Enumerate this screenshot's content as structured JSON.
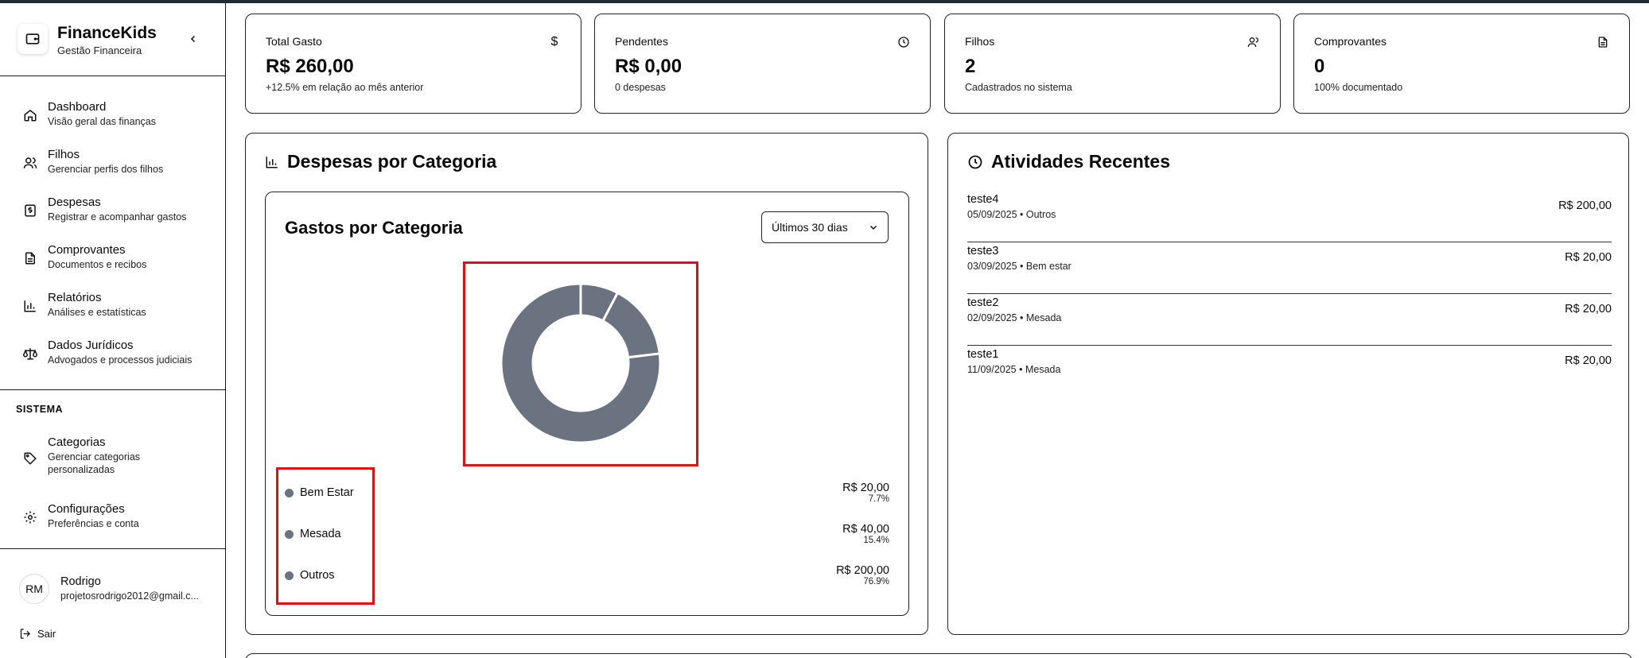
{
  "brand": {
    "name": "FinanceKids",
    "subtitle": "Gestão Financeira"
  },
  "nav": [
    {
      "title": "Dashboard",
      "desc": "Visão geral das finanças",
      "icon": "home-icon"
    },
    {
      "title": "Filhos",
      "desc": "Gerenciar perfis dos filhos",
      "icon": "users-icon"
    },
    {
      "title": "Despesas",
      "desc": "Registrar e acompanhar gastos",
      "icon": "receipt-dollar-icon"
    },
    {
      "title": "Comprovantes",
      "desc": "Documentos e recibos",
      "icon": "document-icon"
    },
    {
      "title": "Relatórios",
      "desc": "Análises e estatísticas",
      "icon": "bar-chart-icon"
    },
    {
      "title": "Dados Jurídicos",
      "desc": "Advogados e processos judiciais",
      "icon": "scale-icon"
    }
  ],
  "system": {
    "label": "SISTEMA",
    "items": [
      {
        "title": "Categorias",
        "desc_line1": "Gerenciar categorias",
        "desc_line2": "personalizadas",
        "icon": "tag-icon"
      },
      {
        "title": "Configurações",
        "desc": "Preferências e conta",
        "icon": "gear-icon"
      }
    ]
  },
  "user": {
    "initials": "RM",
    "name": "Rodrigo",
    "email": "projetosrodrigo2012@gmail.c..."
  },
  "logout": "Sair",
  "stats": [
    {
      "label": "Total Gasto",
      "value": "R$ 260,00",
      "sub": "+12.5% em relação ao mês anterior",
      "icon": "dollar-icon"
    },
    {
      "label": "Pendentes",
      "value": "R$ 0,00",
      "sub": "0 despesas",
      "icon": "clock-icon"
    },
    {
      "label": "Filhos",
      "value": "2",
      "sub": "Cadastrados no sistema",
      "icon": "users-icon"
    },
    {
      "label": "Comprovantes",
      "value": "0",
      "sub": "100% documentado",
      "icon": "document-icon"
    }
  ],
  "expenses_panel": {
    "title": "Despesas por Categoria",
    "chart_title": "Gastos por Categoria",
    "period": "Últimos 30 dias"
  },
  "chart_data": {
    "type": "pie",
    "title": "Gastos por Categoria",
    "categories": [
      "Bem Estar",
      "Mesada",
      "Outros"
    ],
    "values": [
      20,
      40,
      200
    ],
    "amounts": [
      "R$ 20,00",
      "R$ 40,00",
      "R$ 200,00"
    ],
    "percents": [
      "7.7%",
      "15.4%",
      "76.9%"
    ],
    "donut": true,
    "color": "#6b7280",
    "legend_position": "bottom-left"
  },
  "activities": {
    "title": "Atividades Recentes",
    "items": [
      {
        "name": "teste4",
        "meta": "05/09/2025 • Outros",
        "amount": "R$ 200,00"
      },
      {
        "name": "teste3",
        "meta": "03/09/2025 • Bem estar",
        "amount": "R$ 20,00"
      },
      {
        "name": "teste2",
        "meta": "02/09/2025 • Mesada",
        "amount": "R$ 20,00"
      },
      {
        "name": "teste1",
        "meta": "11/09/2025 • Mesada",
        "amount": "R$ 20,00"
      }
    ]
  }
}
